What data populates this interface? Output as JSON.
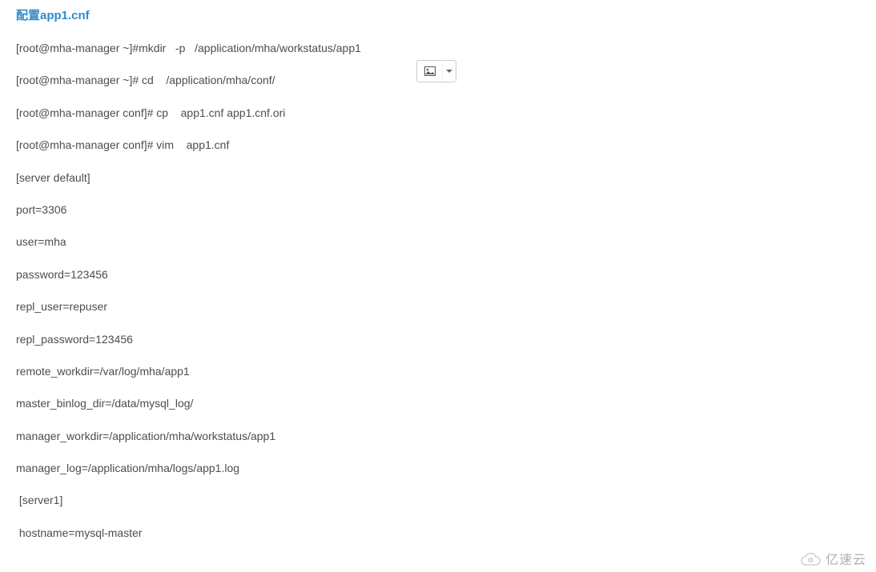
{
  "heading": "配置app1.cnf",
  "lines": [
    "[root@mha-manager ~]#mkdir   -p   /application/mha/workstatus/app1",
    "[root@mha-manager ~]# cd    /application/mha/conf/",
    "[root@mha-manager conf]# cp    app1.cnf app1.cnf.ori",
    "[root@mha-manager conf]# vim    app1.cnf",
    "[server default]",
    "port=3306",
    "user=mha",
    "password=123456",
    "repl_user=repuser",
    "repl_password=123456",
    "remote_workdir=/var/log/mha/app1",
    "master_binlog_dir=/data/mysql_log/",
    "manager_workdir=/application/mha/workstatus/app1",
    "manager_log=/application/mha/logs/app1.log",
    " [server1]",
    " hostname=mysql-master"
  ],
  "watermark": "亿速云"
}
